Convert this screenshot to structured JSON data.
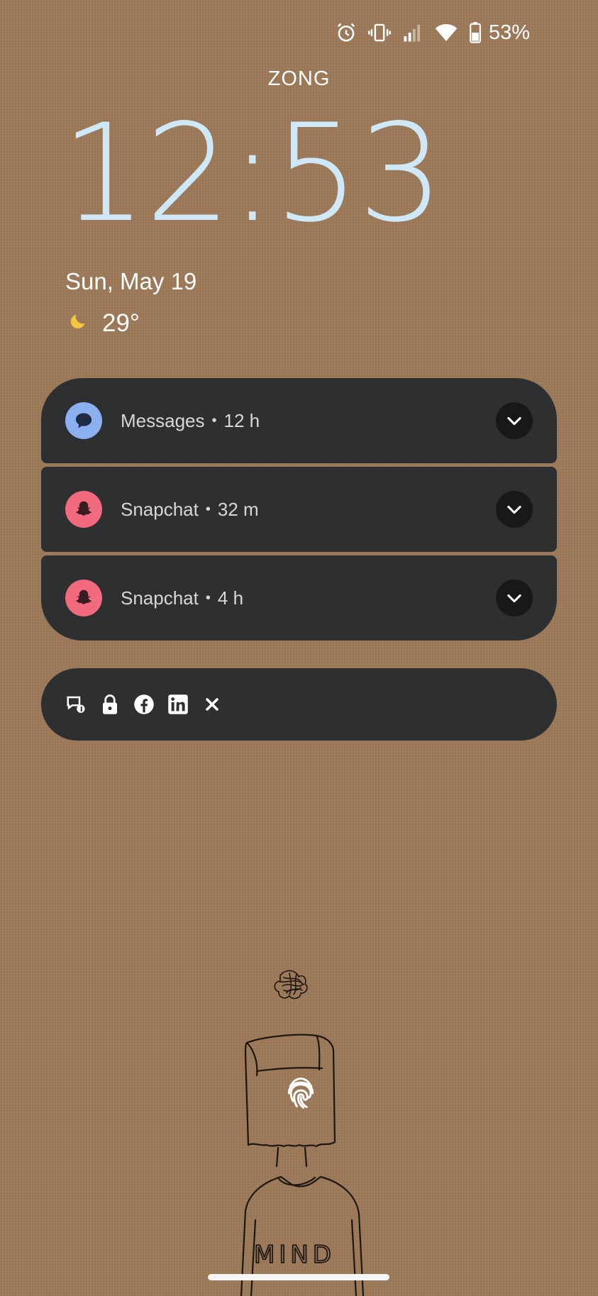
{
  "status_bar": {
    "battery_percent": "53%",
    "icons": [
      "alarm-icon",
      "vibrate-icon",
      "signal-icon",
      "wifi-icon",
      "battery-icon"
    ]
  },
  "carrier": "ZONG",
  "clock": {
    "time": "12:53",
    "color": "#cfe8f7"
  },
  "date": "Sun, May 19",
  "weather": {
    "icon": "moon-icon",
    "temperature": "29°"
  },
  "notifications": [
    {
      "app": "Messages",
      "time": "12 h",
      "icon": "messages-icon",
      "color": "#8ab0f0"
    },
    {
      "app": "Snapchat",
      "time": "32 m",
      "icon": "snapchat-ghost-icon",
      "color": "#f26a7e"
    },
    {
      "app": "Snapchat",
      "time": "4 h",
      "icon": "snapchat-ghost-icon",
      "color": "#f26a7e"
    }
  ],
  "overflow_icons": [
    "messenger-icon",
    "lock-icon",
    "facebook-icon",
    "linkedin-icon",
    "x-icon"
  ],
  "wallpaper": {
    "text": "MIND",
    "background_color": "#9c7a5a"
  }
}
